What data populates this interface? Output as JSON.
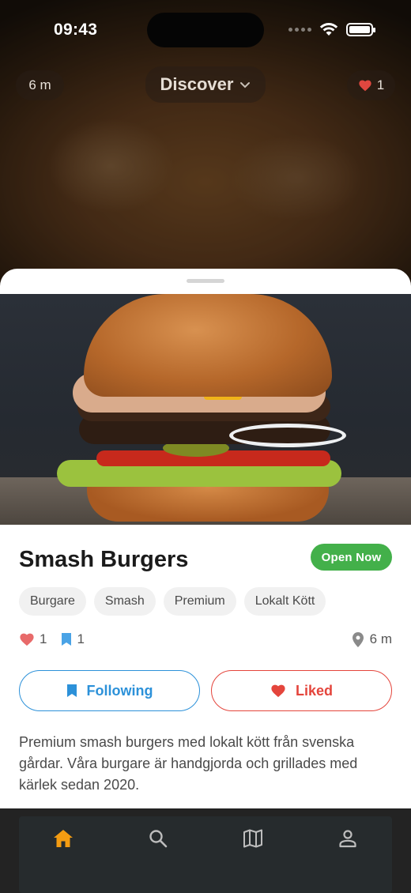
{
  "status_bar": {
    "time": "09:43"
  },
  "top_overlay": {
    "distance_label": "6 m",
    "discover_label": "Discover",
    "likes_count": "1"
  },
  "place": {
    "name": "Smash Burgers",
    "status_badge": "Open Now",
    "tags": [
      "Burgare",
      "Smash",
      "Premium",
      "Lokalt Kött"
    ],
    "likes": "1",
    "bookmarks": "1",
    "distance": "6 m",
    "follow_button": "Following",
    "like_button": "Liked",
    "description": "Premium smash burgers med lokalt kött från svenska gårdar. Våra burgare är handgjorda och grillades med kärlek sedan 2020."
  },
  "bottom_nav": {
    "items": [
      "home-icon",
      "search-icon",
      "map-icon",
      "profile-icon"
    ],
    "active": "home-icon"
  },
  "colors": {
    "accent_orange": "#f39c12",
    "open_green": "#43b04a",
    "follow_blue": "#2c91d9",
    "like_red": "#e4453c"
  }
}
